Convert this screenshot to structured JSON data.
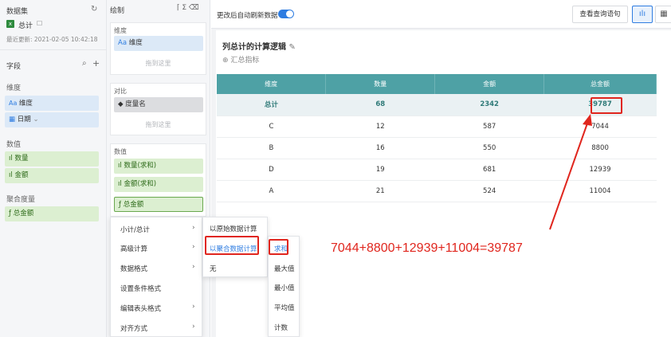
{
  "left": {
    "dataset_title": "数据集",
    "dataset_name": "总计",
    "last_update": "最近更新: 2021-02-05 10:42:18",
    "fields_title": "字段",
    "dimension_title": "维度",
    "dimensions": [
      "维度",
      "日期"
    ],
    "value_title": "数值",
    "values": [
      "数量",
      "金额"
    ],
    "agg_title": "聚合度量",
    "aggs": [
      "总金额"
    ]
  },
  "mid": {
    "title": "绘制",
    "dim_title": "维度",
    "dim_chip": "维度",
    "drag_hint": "拖到这里",
    "compare_title": "对比",
    "compare_chip": "度量名",
    "value_title": "数值",
    "value_chips": [
      "数量(求和)",
      "金额(求和)",
      "总金额"
    ]
  },
  "topbar": {
    "toggle_label": "更改后自动刷新数据",
    "query_button": "查看查询语句"
  },
  "chart": {
    "title": "列总计的计算逻辑",
    "subtitle": "汇总指标"
  },
  "table": {
    "headers": [
      "维度",
      "数量",
      "金额",
      "总金额"
    ],
    "total": [
      "总计",
      "68",
      "2342",
      "39787"
    ],
    "rows": [
      [
        "C",
        "12",
        "587",
        "7044"
      ],
      [
        "B",
        "16",
        "550",
        "8800"
      ],
      [
        "D",
        "19",
        "681",
        "12939"
      ],
      [
        "A",
        "21",
        "524",
        "11004"
      ]
    ]
  },
  "context_menu": [
    "小计/总计",
    "高级计算",
    "数据格式",
    "设置条件格式",
    "编辑表头格式",
    "对齐方式"
  ],
  "submenu1": [
    "以原始数据计算",
    "以聚合数据计算",
    "无"
  ],
  "submenu2": [
    "求和",
    "最大值",
    "最小值",
    "平均值",
    "计数"
  ],
  "annotation": "7044+8800+12939+11004=39787",
  "colors": {
    "accent": "#2f7de1",
    "header": "#4ea1a5",
    "red": "#e0261e"
  }
}
